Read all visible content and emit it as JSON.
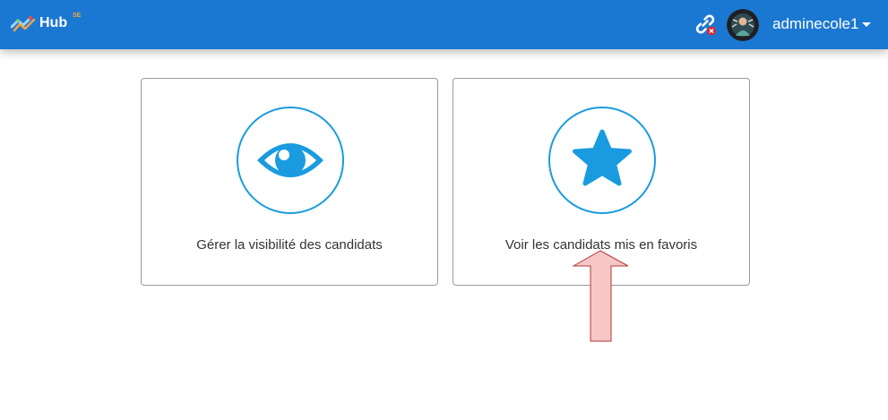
{
  "header": {
    "logo_text": "Hub",
    "logo_sup": "SE",
    "username": "adminecole1",
    "icons": {
      "link": "link-icon",
      "avatar": "user-avatar",
      "menu": "chevron-down-icon"
    },
    "colors": {
      "bar": "#1b78d2",
      "logo_sup": "#f0a73a",
      "badge": "#d9262e"
    }
  },
  "cards": [
    {
      "label": "Gérer la visibilité des candidats",
      "icon": "eye-icon"
    },
    {
      "label": "Voir les candidats mis en favoris",
      "icon": "star-icon"
    }
  ],
  "colors": {
    "accent": "#1a9be0",
    "card_border": "#9a9a9a",
    "annotation_arrow": "#f7c6c6"
  }
}
